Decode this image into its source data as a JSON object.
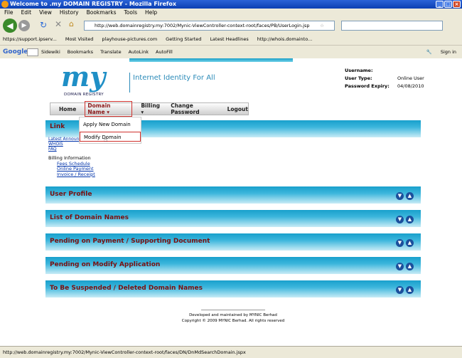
{
  "window": {
    "title": "Welcome to .my DOMAIN REGISTRY - Mozilla Firefox"
  },
  "menubar": [
    "File",
    "Edit",
    "View",
    "History",
    "Bookmarks",
    "Tools",
    "Help"
  ],
  "nav": {
    "url": "http://web.domainregistry.my:7002/Mynic-ViewController-context-root/faces/PB/UserLogin.jsp"
  },
  "bookmarks": [
    "https://support.ipserv...",
    "Most Visited",
    "playhouse-pictures.com",
    "Getting Started",
    "Latest Headlines",
    "http://whois.domainto..."
  ],
  "googlebar": {
    "logo": "Google",
    "items": [
      "Sidewiki",
      "Bookmarks",
      "Translate",
      "AutoLink",
      "AutoFill"
    ],
    "signin": "Sign in"
  },
  "page": {
    "logo_text": "my",
    "logo_sub": "DOMAIN REGISTRY",
    "tagline": "Internet Identity For All",
    "user": {
      "username_label": "Username:",
      "usertype_label": "User Type:",
      "usertype_value": "Online User",
      "expiry_label": "Password Expiry:",
      "expiry_value": "04/08/2010"
    },
    "menu": {
      "home": "Home",
      "domain": "Domain Name",
      "billing": "Billing",
      "change_password": "Change Password",
      "logout": "Logout"
    },
    "dropdown": [
      "Apply New Domain",
      "Modify Domain"
    ],
    "sections": {
      "link": "Link",
      "user_profile": "User Profile",
      "domain_list": "List of Domain Names",
      "pending_payment": "Pending on Payment / Supporting Document",
      "pending_modify": "Pending on Modify Application",
      "suspended": "To Be Suspended / Deleted Domain Names"
    },
    "links": [
      "Latest Announ",
      "WHOIS",
      "FAQ"
    ],
    "billing_info": {
      "heading": "Billing Information",
      "items": [
        "Fees Schedule",
        "Online Payment",
        "Invoice / Receipt"
      ]
    },
    "footer": {
      "line1": "Developed and maintained by MYNIC Berhad",
      "line2": "Copyright © 2009 MYNIC Berhad.  All rights reserved"
    }
  },
  "status": "http://web.domainregistry.my:7002/Mynic-ViewController-context-root/faces/DN/DnMdSearchDomain.jspx"
}
